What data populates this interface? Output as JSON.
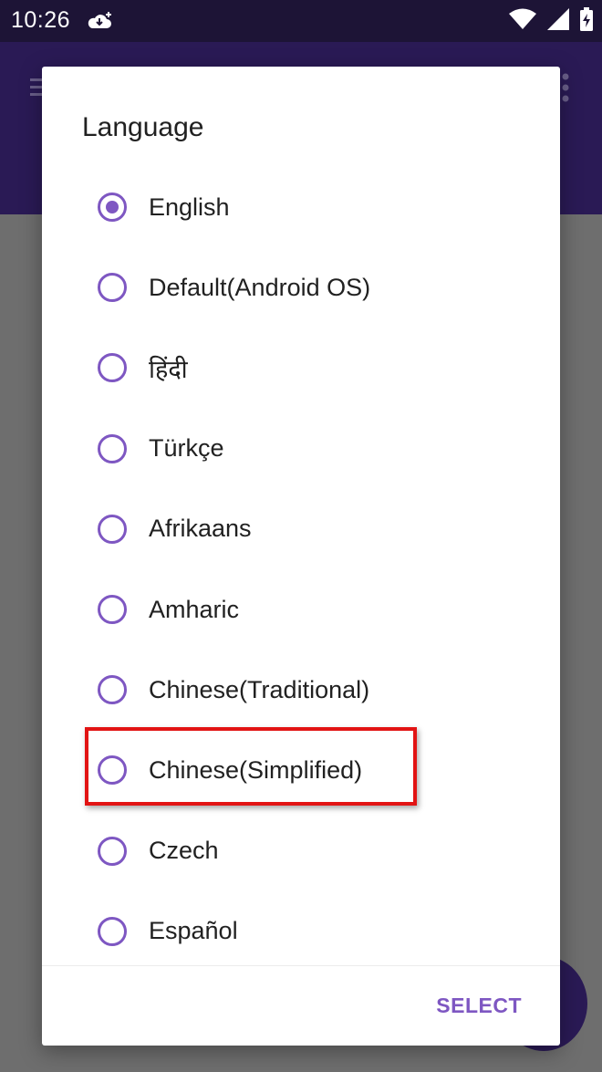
{
  "status_bar": {
    "time": "10:26",
    "icons": [
      "cloud-download-icon",
      "wifi-icon",
      "signal-icon",
      "battery-charging-icon"
    ]
  },
  "app_bar": {
    "icons": [
      "menu-icon",
      "more-vert-icon"
    ]
  },
  "dialog": {
    "title": "Language",
    "options": [
      {
        "label": "English",
        "selected": true
      },
      {
        "label": "Default(Android OS)",
        "selected": false
      },
      {
        "label": "हिंदी",
        "selected": false
      },
      {
        "label": "Türkçe",
        "selected": false
      },
      {
        "label": "Afrikaans",
        "selected": false
      },
      {
        "label": "Amharic",
        "selected": false
      },
      {
        "label": "Chinese(Traditional)",
        "selected": false
      },
      {
        "label": "Chinese(Simplified)",
        "selected": false
      },
      {
        "label": "Czech",
        "selected": false
      },
      {
        "label": "Español",
        "selected": false
      }
    ],
    "select_label": "SELECT"
  },
  "colors": {
    "accent": "#7e57c2",
    "status_bar": "#1d1436",
    "app_bar": "#2a1a55",
    "scrim": "#6e6e6e",
    "highlight": "#e21414"
  }
}
